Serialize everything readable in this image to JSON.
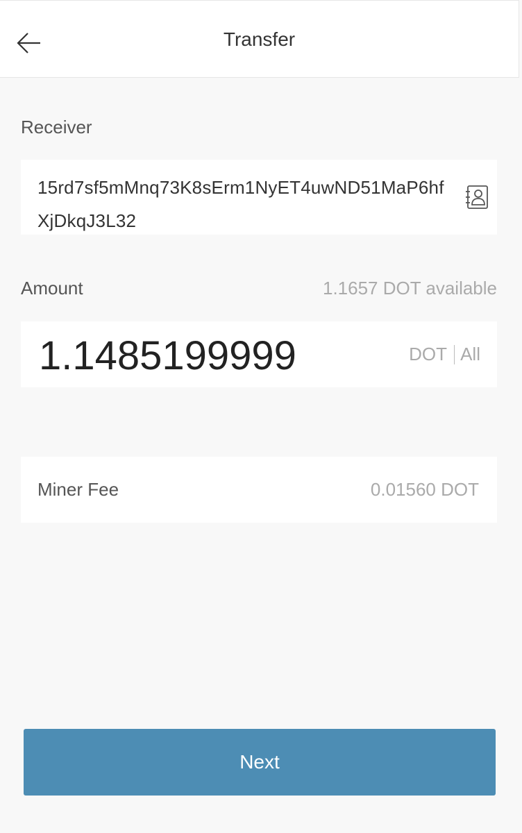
{
  "header": {
    "title": "Transfer",
    "back_icon": "arrow-left-icon"
  },
  "receiver": {
    "label": "Receiver",
    "address": "15rd7sf5mMnq73K8sErm1NyET4uwND51MaP6hfXjDkqJ3L32",
    "contact_icon": "contact-book-icon"
  },
  "amount": {
    "label": "Amount",
    "available": "1.1657 DOT available",
    "value": "1.1485199999",
    "unit": "DOT",
    "all_label": "All"
  },
  "fee": {
    "label": "Miner Fee",
    "value": "0.01560 DOT"
  },
  "next_button": {
    "label": "Next"
  },
  "colors": {
    "accent": "#4d8db4",
    "background": "#f8f8f8",
    "card": "#ffffff",
    "muted_text": "#aaaaaa"
  }
}
